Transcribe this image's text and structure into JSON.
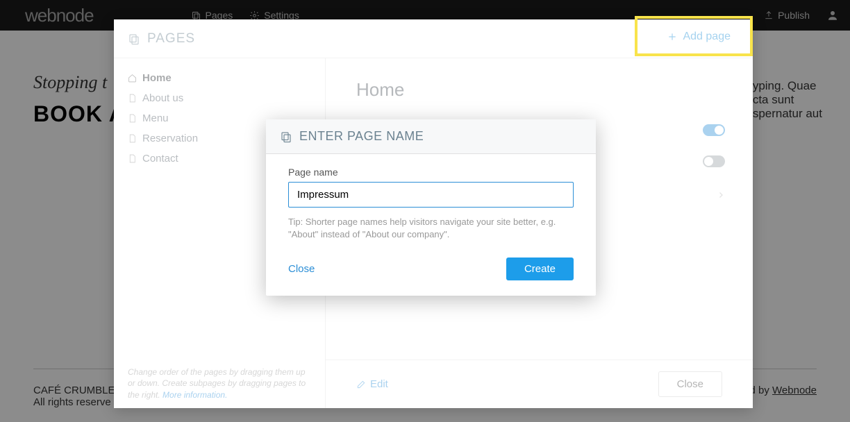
{
  "topnav": {
    "logo": "webnode",
    "pages": "Pages",
    "settings": "Settings",
    "publish": "Publish"
  },
  "bg": {
    "tagline": "Stopping t",
    "heading": "BOOK A",
    "right1": "yping. Quae",
    "right2": "cta sunt",
    "right3": "spernatur aut",
    "footer_name": "CAFÉ CRUMBLE",
    "footer_rights": "All rights reserve",
    "footer_right": "ed by ",
    "footer_link": "Webnode"
  },
  "pages_panel": {
    "title": "PAGES",
    "add_page": "Add page",
    "items": [
      {
        "label": "Home",
        "active": true,
        "icon": "home"
      },
      {
        "label": "About us",
        "active": false,
        "icon": "file"
      },
      {
        "label": "Menu",
        "active": false,
        "icon": "file"
      },
      {
        "label": "Reservation",
        "active": false,
        "icon": "file"
      },
      {
        "label": "Contact",
        "active": false,
        "icon": "file"
      }
    ],
    "footer_hint": "Change order of the pages by dragging them up or down. Create subpages by dragging pages to the right. ",
    "footer_more": "More information.",
    "main_title": "Home",
    "edit": "Edit",
    "close": "Close"
  },
  "modal": {
    "title": "ENTER PAGE NAME",
    "label": "Page name",
    "value": "Impressum",
    "tip": "Tip: Shorter page names help visitors navigate your site better, e.g. \"About\" instead of \"About our company\".",
    "close": "Close",
    "create": "Create"
  }
}
